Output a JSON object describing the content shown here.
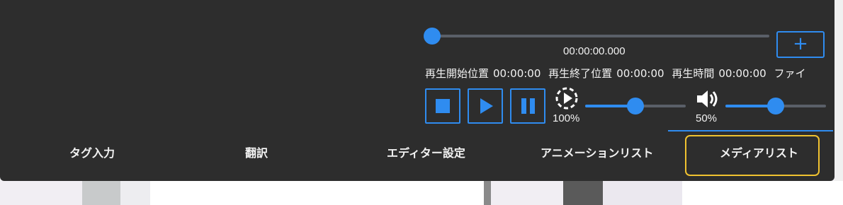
{
  "player": {
    "current_time": "00:00:00.000",
    "info": [
      {
        "label": "再生開始位置",
        "value": "00:00:00"
      },
      {
        "label": "再生終了位置",
        "value": "00:00:00"
      },
      {
        "label": "再生時間",
        "value": "00:00:00"
      },
      {
        "label": "ファイ",
        "value": ""
      }
    ],
    "add_label": "+",
    "seek_position": 0,
    "speed": {
      "value_label": "100%",
      "level": 0.5
    },
    "volume": {
      "value_label": "50%",
      "level": 0.5
    }
  },
  "tabs": [
    {
      "label": "タグ入力",
      "active": false
    },
    {
      "label": "翻訳",
      "active": false
    },
    {
      "label": "エディター設定",
      "active": false
    },
    {
      "label": "アニメーションリスト",
      "active": false
    },
    {
      "label": "メディアリスト",
      "active": true
    }
  ],
  "colors": {
    "accent": "#2f8cf0",
    "panel_bg": "#2d2d2d",
    "focus": "#f0c230",
    "track": "#5a5f68"
  },
  "icons": {
    "stop": "stop-icon",
    "play": "play-icon",
    "pause": "pause-icon",
    "speed": "playback-speed-icon",
    "volume": "volume-icon",
    "add": "plus-icon"
  }
}
